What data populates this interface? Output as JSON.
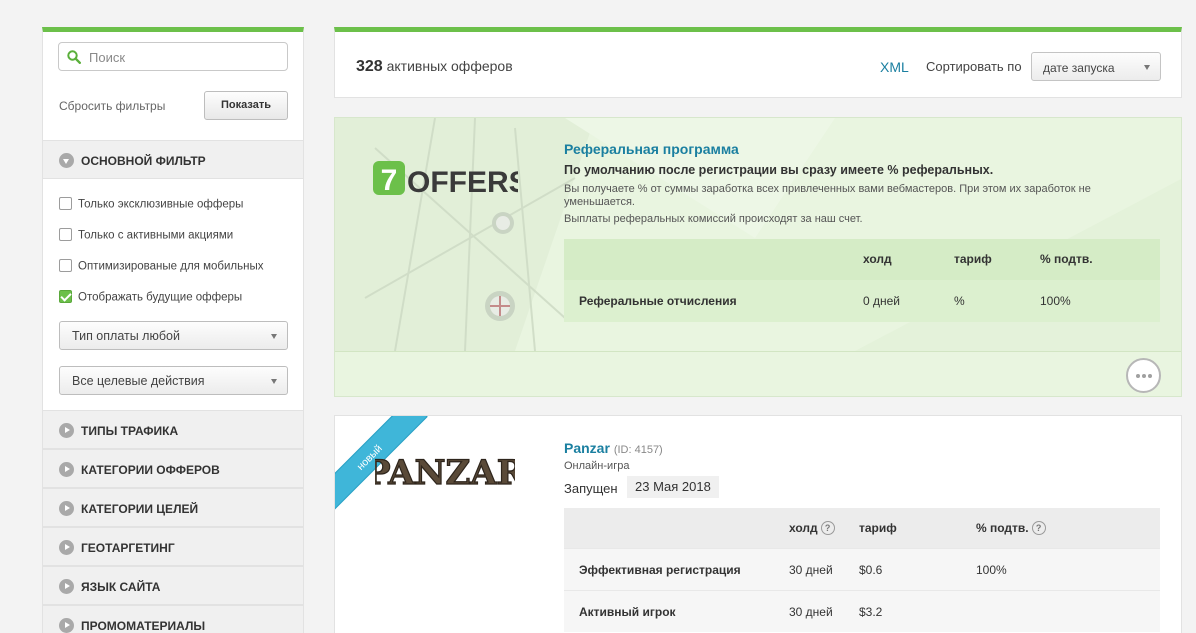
{
  "sidebar": {
    "search_placeholder": "Поиск",
    "reset_label": "Сбросить фильтры",
    "show_label": "Показать",
    "main_filter": "ОСНОВНОЙ ФИЛЬТР",
    "checkboxes": [
      {
        "label": "Только эксклюзивные офферы",
        "checked": false
      },
      {
        "label": "Только с активными акциями",
        "checked": false
      },
      {
        "label": "Оптимизированые для мобильных",
        "checked": false
      },
      {
        "label": "Отображать будущие офферы",
        "checked": true
      }
    ],
    "payment_select": "Тип оплаты любой",
    "actions_select": "Все целевые действия",
    "sections": [
      "ТИПЫ ТРАФИКА",
      "КАТЕГОРИИ ОФФЕРОВ",
      "КАТЕГОРИИ ЦЕЛЕЙ",
      "ГЕОТАРГЕТИНГ",
      "ЯЗЫК САЙТА",
      "ПРОМОМАТЕРИАЛЫ"
    ]
  },
  "topbar": {
    "count": "328",
    "count_label": "активных офферов",
    "xml": "XML",
    "sort_label": "Сортировать по",
    "sort_value": "дате запуска"
  },
  "referral": {
    "logo_text": "OFFERS",
    "logo_digit": "7",
    "title": "Реферальная программа",
    "subtitle": "По умолчанию после регистрации вы сразу имеете % реферальных.",
    "p1": "Вы получаете % от суммы заработка всех привлеченных вами вебмастеров. При этом их заработок не уменьшается.",
    "p2": "Выплаты реферальных комиссий происходят за наш счет.",
    "headers": {
      "hold": "холд",
      "tariff": "тариф",
      "approve": "% подтв."
    },
    "row": {
      "name": "Реферальные отчисления",
      "hold": "0 дней",
      "tariff": "%",
      "approve": "100%"
    }
  },
  "offer": {
    "ribbon": "новый",
    "logo_text": "PANZAR",
    "title": "Panzar",
    "id": "(ID: 4157)",
    "category": "Онлайн-игра",
    "launched_label": "Запущен",
    "launched_date": "23 Мая 2018",
    "headers": {
      "hold": "холд",
      "tariff": "тариф",
      "approve": "% подтв.",
      "help": "?"
    },
    "rows": [
      {
        "name": "Эффективная регистрация",
        "hold": "30 дней",
        "tariff": "$0.6",
        "approve": "100%"
      },
      {
        "name": "Активный игрок",
        "hold": "30 дней",
        "tariff": "$3.2",
        "approve": ""
      }
    ]
  },
  "colors": {
    "accent": "#6cc04a",
    "link": "#1a7fa0",
    "ribbon": "#3fb6d9"
  }
}
